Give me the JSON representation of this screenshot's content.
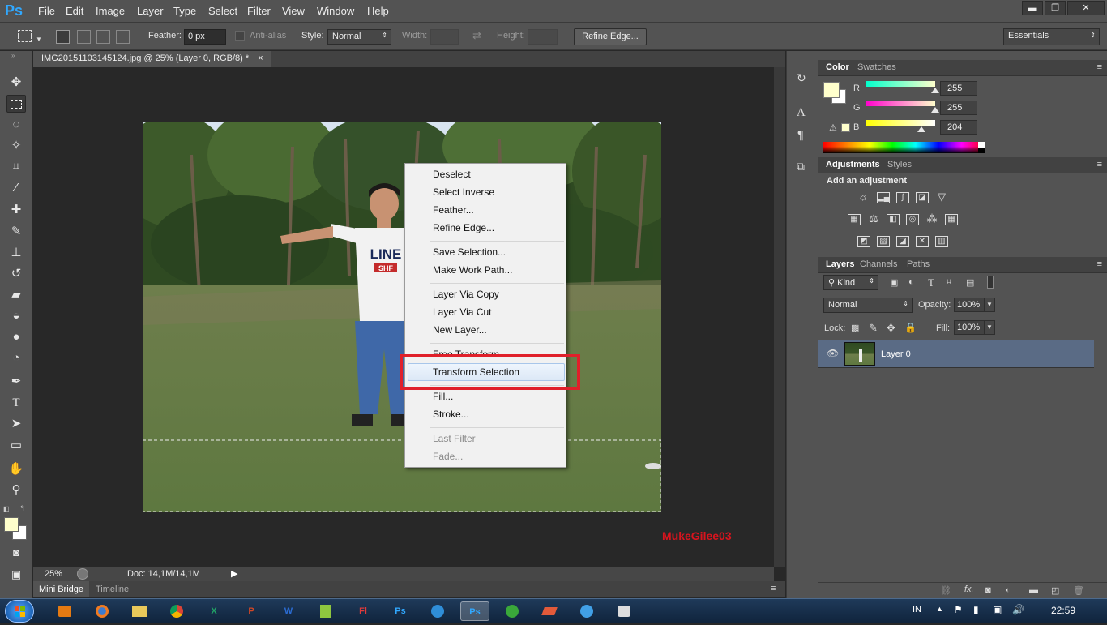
{
  "app": {
    "logo": "Ps"
  },
  "menubar": {
    "items": [
      "File",
      "Edit",
      "Image",
      "Layer",
      "Type",
      "Select",
      "Filter",
      "View",
      "Window",
      "Help"
    ]
  },
  "window_controls": {
    "minimize": "▬",
    "restore": "❐",
    "close": "✕"
  },
  "options": {
    "feather_label": "Feather:",
    "feather_value": "0 px",
    "antialias_label": "Anti-alias",
    "style_label": "Style:",
    "style_value": "Normal",
    "width_label": "Width:",
    "height_label": "Height:",
    "refine_edge": "Refine Edge...",
    "workspace": "Essentials"
  },
  "document": {
    "tab_title": "IMG20151103145124.jpg @ 25% (Layer 0, RGB/8) *",
    "tab_close": "×",
    "zoom": "25%",
    "doc_size": "Doc: 14,1M/14,1M",
    "bottom_tabs": [
      "Mini Bridge",
      "Timeline"
    ],
    "watermark": "MukeGilee03",
    "shirt_text_1": "LINE",
    "shirt_text_2": "SHF"
  },
  "context_menu": {
    "items": [
      "Deselect",
      "Select Inverse",
      "Feather...",
      "Refine Edge...",
      "Save Selection...",
      "Make Work Path...",
      "Layer Via Copy",
      "Layer Via Cut",
      "New Layer...",
      "Free Transform",
      "Transform Selection",
      "Fill...",
      "Stroke...",
      "Last Filter",
      "Fade..."
    ],
    "highlighted": "Transform Selection"
  },
  "color_panel": {
    "tabs": [
      "Color",
      "Swatches"
    ],
    "labels": [
      "R",
      "G",
      "B"
    ],
    "r": "255",
    "g": "255",
    "b": "204",
    "r_frac": 1.0,
    "g_frac": 1.0,
    "b_frac": 0.8,
    "foreground": "#ffffcc"
  },
  "adjustments_panel": {
    "tabs": [
      "Adjustments",
      "Styles"
    ],
    "heading": "Add an adjustment"
  },
  "layers_panel": {
    "tabs": [
      "Layers",
      "Channels",
      "Paths"
    ],
    "kind": "Kind",
    "blend_mode": "Normal",
    "opacity_label": "Opacity:",
    "opacity_value": "100%",
    "lock_label": "Lock:",
    "fill_label": "Fill:",
    "fill_value": "100%",
    "layers": [
      {
        "name": "Layer 0"
      }
    ]
  },
  "taskbar": {
    "apps": [
      "X",
      "P",
      "W",
      "Fl",
      "Ps",
      "Ps"
    ],
    "language": "IN",
    "clock": "22:59"
  }
}
